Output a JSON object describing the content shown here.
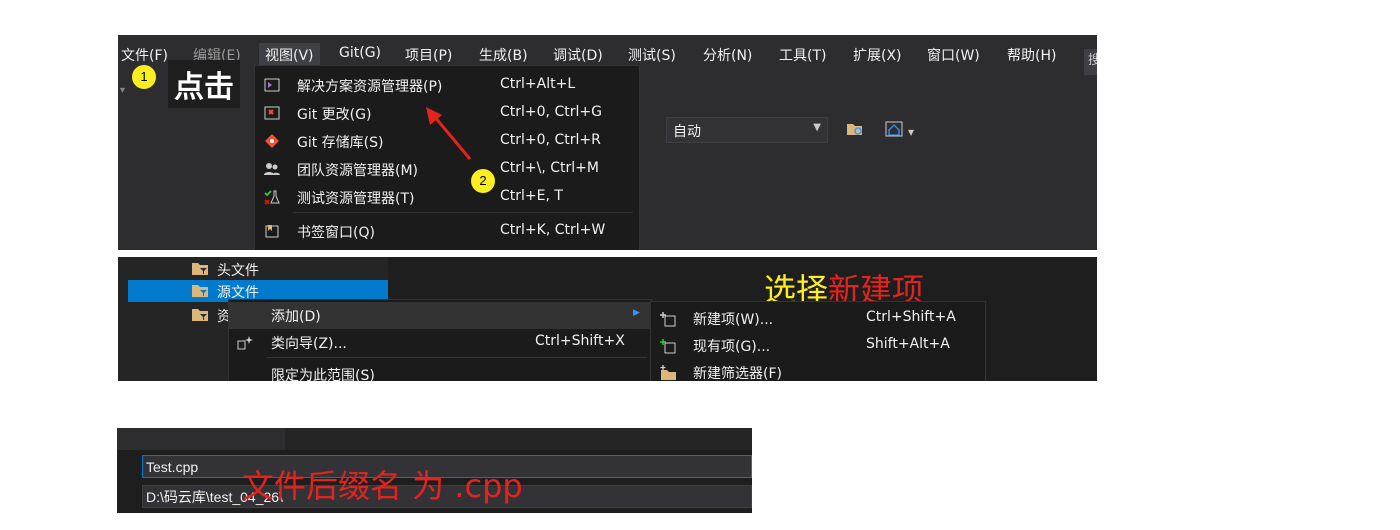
{
  "panel1": {
    "menu": [
      "文件(F)",
      "编辑(E)",
      "视图(V)",
      "Git(G)",
      "项目(P)",
      "生成(B)",
      "调试(D)",
      "测试(S)",
      "分析(N)",
      "工具(T)",
      "扩展(X)",
      "窗口(W)",
      "帮助(H)"
    ],
    "search_partial": "搜",
    "badge1": "1",
    "annotation_click": "点击",
    "badge2": "2",
    "config_combo": "自动",
    "view_menu": [
      {
        "label": "解决方案资源管理器(P)",
        "shortcut": "Ctrl+Alt+L",
        "icon": "solution-explorer-icon"
      },
      {
        "label": "Git 更改(G)",
        "shortcut": "Ctrl+0, Ctrl+G",
        "icon": "git-changes-icon"
      },
      {
        "label": "Git 存储库(S)",
        "shortcut": "Ctrl+0, Ctrl+R",
        "icon": "git-repository-icon"
      },
      {
        "label": "团队资源管理器(M)",
        "shortcut": "Ctrl+\\, Ctrl+M",
        "icon": "team-explorer-icon"
      },
      {
        "label": "测试资源管理器(T)",
        "shortcut": "Ctrl+E, T",
        "icon": "test-explorer-icon"
      },
      {
        "label": "书签窗口(Q)",
        "shortcut": "Ctrl+K, Ctrl+W",
        "icon": "bookmark-icon"
      }
    ]
  },
  "panel2": {
    "tree": [
      {
        "label": "头文件",
        "selected": false
      },
      {
        "label": "源文件",
        "selected": true
      },
      {
        "label": "资",
        "selected": false
      }
    ],
    "context_menu": [
      {
        "label": "添加(D)",
        "shortcut": "",
        "submenu": true
      },
      {
        "label": "类向导(Z)...",
        "shortcut": "Ctrl+Shift+X",
        "submenu": false
      },
      {
        "label": "限定为此范围(S)",
        "shortcut": "",
        "submenu": false
      }
    ],
    "submenu": [
      {
        "label": "新建项(W)...",
        "shortcut": "Ctrl+Shift+A",
        "icon": "new-item-icon"
      },
      {
        "label": "现有项(G)...",
        "shortcut": "Shift+Alt+A",
        "icon": "existing-item-icon"
      },
      {
        "label": "新建筛选器(F)",
        "shortcut": "",
        "icon": "new-filter-icon"
      }
    ],
    "annotation_part1": "选择",
    "annotation_part2": "新建项",
    "annotation_colors": {
      "part1": "#fcee21",
      "part2": "#e4231e"
    }
  },
  "panel3": {
    "name_value": "Test.cpp",
    "path_value": "D:\\码云库\\test_04_26\\",
    "annotation": "文件后缀名 为 .cpp"
  }
}
